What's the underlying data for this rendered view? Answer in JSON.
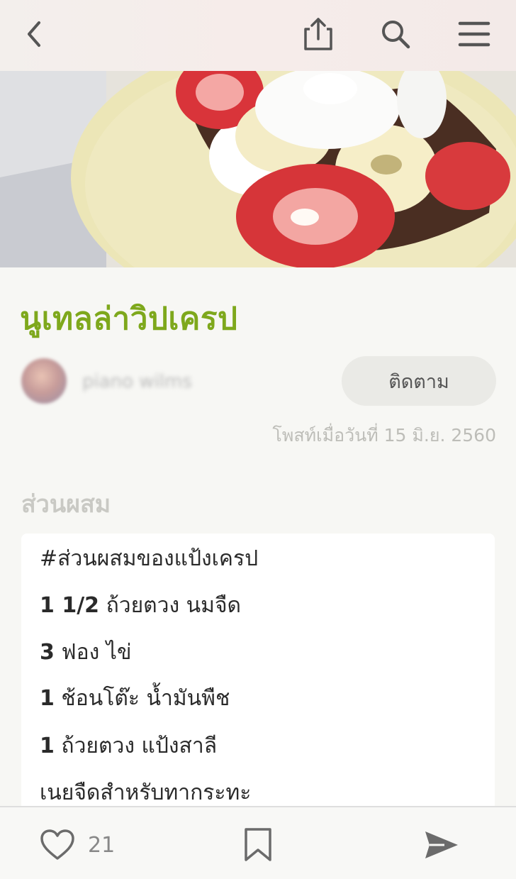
{
  "header": {
    "back_icon": "chevron-left-icon",
    "share_icon": "share-icon",
    "search_icon": "search-icon",
    "menu_icon": "hamburger-menu-icon"
  },
  "recipe": {
    "title": "นูเทลล่าวิปเครป",
    "author": "piano wilms",
    "follow_label": "ติดตาม",
    "posted": "โพสท์เมื่อวันที่ 15 มิ.ย. 2560"
  },
  "ingredients": {
    "heading": "ส่วนผสม",
    "lines": [
      {
        "qty": "",
        "text": "#ส่วนผสมของแป้งเครป"
      },
      {
        "qty": "1 1/2",
        "text": " ถ้วยตวง นมจืด"
      },
      {
        "qty": "3",
        "text": " ฟอง ไข่"
      },
      {
        "qty": "1",
        "text": " ช้อนโต๊ะ น้ำมันพืช"
      },
      {
        "qty": "1",
        "text": " ถ้วยตวง แป้งสาลี"
      },
      {
        "qty": "",
        "text": "เนยจืดสำหรับทากระทะ"
      }
    ]
  },
  "footer": {
    "like_icon": "heart-icon",
    "like_count": "21",
    "bookmark_icon": "bookmark-icon",
    "send_icon": "send-icon"
  },
  "colors": {
    "title_green": "#7ea81c",
    "icon_gray": "#6b6b6b"
  }
}
